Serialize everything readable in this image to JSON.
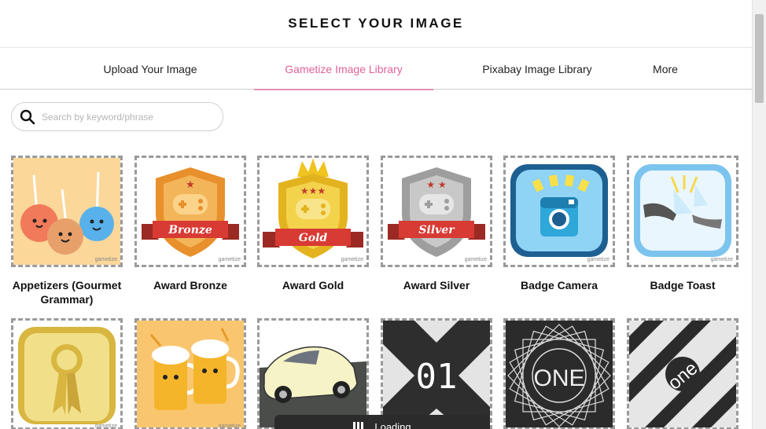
{
  "modal": {
    "title": "SELECT YOUR IMAGE"
  },
  "tabs": [
    {
      "label": "Upload Your Image"
    },
    {
      "label": "Gametize Image Library"
    },
    {
      "label": "Pixabay Image Library"
    },
    {
      "label": "More"
    }
  ],
  "search": {
    "placeholder": "Search by keyword/phrase",
    "value": ""
  },
  "images": [
    {
      "caption": "Appetizers (Gourmet Grammar)",
      "watermark": "gametize"
    },
    {
      "caption": "Award Bronze",
      "watermark": "gametize",
      "banner": "Bronze"
    },
    {
      "caption": "Award Gold",
      "watermark": "gametize",
      "banner": "Gold"
    },
    {
      "caption": "Award Silver",
      "watermark": "gametize",
      "banner": "Silver"
    },
    {
      "caption": "Badge Camera",
      "watermark": "gametize"
    },
    {
      "caption": "Badge Toast",
      "watermark": "gametize"
    },
    {
      "caption": "",
      "watermark": "gametize"
    },
    {
      "caption": "",
      "watermark": "gametize"
    },
    {
      "caption": "",
      "watermark": ""
    },
    {
      "caption": "",
      "watermark": "",
      "text": "01"
    },
    {
      "caption": "",
      "watermark": "",
      "text": "ONE"
    },
    {
      "caption": "",
      "watermark": "",
      "text": "one"
    }
  ],
  "loading": {
    "label": "Loading"
  },
  "colors": {
    "accent": "#e0619a",
    "tab_underline": "#e58db5",
    "dashed_border": "#9a9a9a"
  }
}
